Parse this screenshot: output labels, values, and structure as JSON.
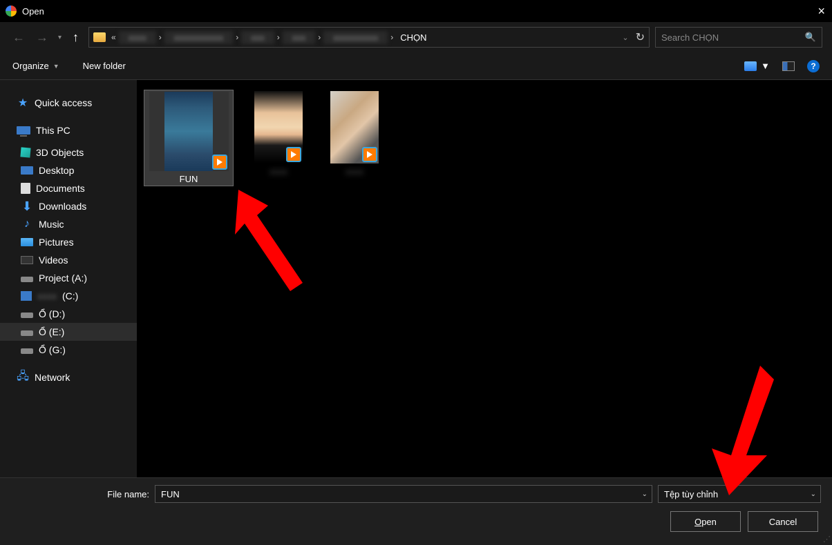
{
  "window": {
    "title": "Open"
  },
  "breadcrumb": {
    "current": "CHỌN"
  },
  "search": {
    "placeholder": "Search CHỌN"
  },
  "toolbar": {
    "organize": "Organize",
    "new_folder": "New folder"
  },
  "sidebar": {
    "quick_access": "Quick access",
    "this_pc": "This PC",
    "items": [
      "3D Objects",
      "Desktop",
      "Documents",
      "Downloads",
      "Music",
      "Pictures",
      "Videos",
      "Project (A:)",
      "(C:)",
      "Ổ (D:)",
      "Ổ (E:)",
      "Ổ (G:)"
    ],
    "network": "Network"
  },
  "files": {
    "item1": "FUN"
  },
  "footer": {
    "filename_label": "File name:",
    "filename_value": "FUN",
    "filetype": "Tệp tùy chỉnh",
    "open": "Open",
    "cancel": "Cancel"
  }
}
